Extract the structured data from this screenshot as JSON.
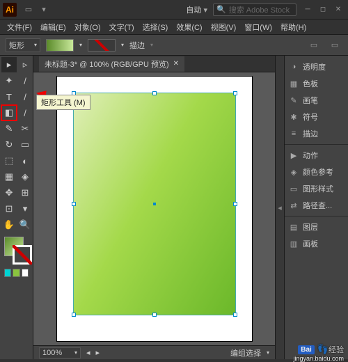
{
  "titlebar": {
    "auto_label": "自动",
    "search_placeholder": "搜索 Adobe Stock"
  },
  "menubar": {
    "items": [
      "文件(F)",
      "编辑(E)",
      "对象(O)",
      "文字(T)",
      "选择(S)",
      "效果(C)",
      "视图(V)",
      "窗口(W)",
      "帮助(H)"
    ]
  },
  "optbar": {
    "shape_label": "矩形",
    "stroke_label": "描边"
  },
  "doc": {
    "tab_title": "未标题-3* @ 100% (RGB/GPU 预览)"
  },
  "tooltip": {
    "text": "矩形工具 (M)"
  },
  "status": {
    "zoom": "100%",
    "mode": "编组选择"
  },
  "panels": {
    "items": [
      "透明度",
      "色板",
      "画笔",
      "符号",
      "描边",
      "动作",
      "颜色参考",
      "图形样式",
      "路径查...",
      "图层",
      "画板"
    ]
  },
  "tool_icons": [
    "▸",
    "▹",
    "✦",
    "/",
    "T",
    "/",
    "◧",
    "/",
    "✎",
    "✂",
    "↻",
    "▭",
    "⬚",
    "◐",
    "▦",
    "◈",
    "✥",
    "⊞",
    "⊡",
    "▾",
    "✋",
    "🔍"
  ],
  "panel_icons": [
    "◑",
    "▦",
    "✎",
    "✱",
    "≡",
    "▶",
    "◈",
    "▭",
    "⇄",
    "▤",
    "▥"
  ],
  "miniswatches": [
    "#00d4d4",
    "#8ac43f",
    "#ffffff"
  ],
  "watermark": {
    "logo": "Bai",
    "brand": "经验",
    "url": "jingyan.baidu.com"
  }
}
